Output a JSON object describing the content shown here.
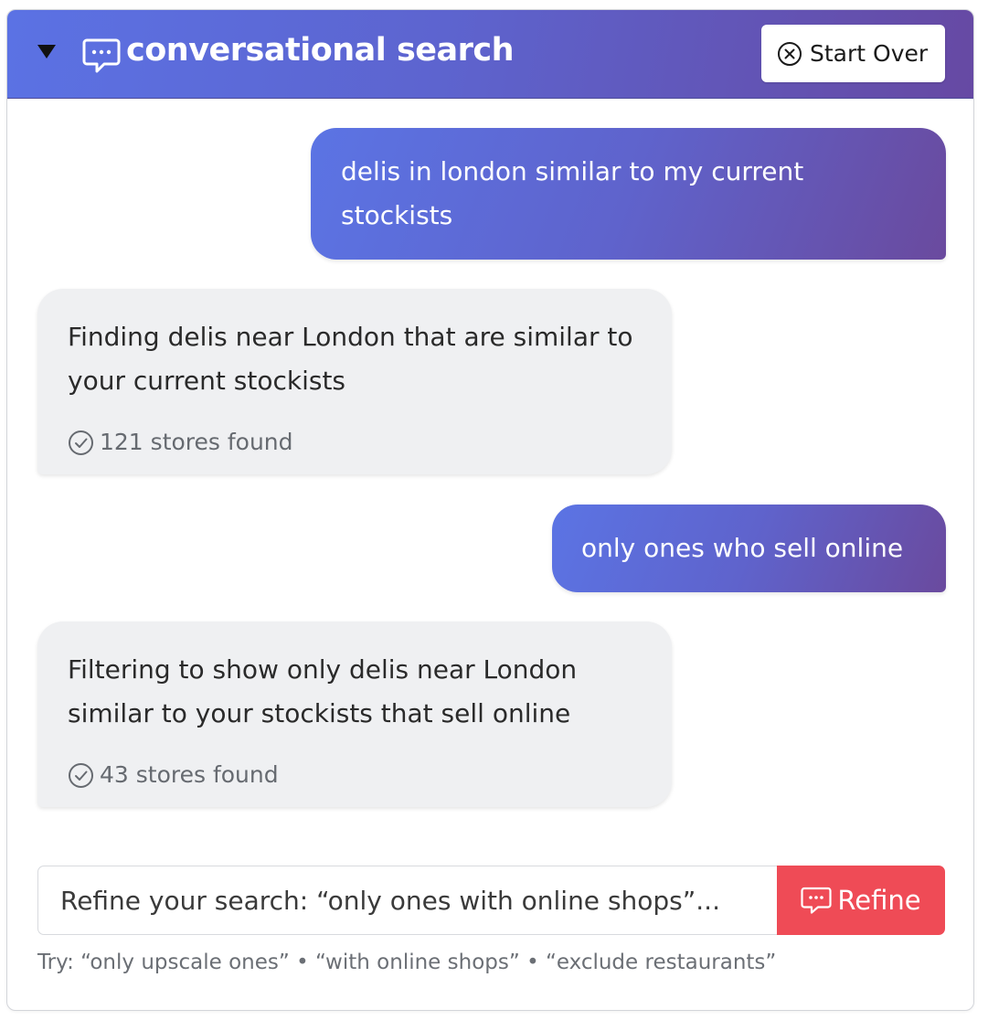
{
  "header": {
    "title": "conversational search",
    "toggle_icon": "triangle-down-icon",
    "title_icon": "chat-bubble-icon",
    "start_over_label": "Start Over",
    "start_over_icon": "circle-x-icon",
    "gradient_start": "#5b72e4",
    "gradient_end": "#6649a3"
  },
  "messages": [
    {
      "role": "user",
      "text": "delis in london similar to my current stockists"
    },
    {
      "role": "assistant",
      "text": "Finding delis near London that are similar to your current stockists",
      "result_count": "121 stores found",
      "result_icon": "check-circle-icon"
    },
    {
      "role": "user",
      "text": "only ones who sell online"
    },
    {
      "role": "assistant",
      "text": "Filtering to show only delis near London similar to your stockists that sell online",
      "result_count": "43 stores found",
      "result_icon": "check-circle-icon"
    }
  ],
  "refine": {
    "placeholder": "Refine your search: “only ones with online shops”...",
    "value": "",
    "button_label": "Refine",
    "button_icon": "chat-bubble-icon",
    "button_color": "#ef4b56"
  },
  "hint": {
    "text": "Try: “only upscale ones” • “with online shops” • “exclude restaurants”"
  },
  "colors": {
    "bot_bubble": "#eff0f2",
    "user_bubble_start": "#5b74e4",
    "user_bubble_end": "#6a4a9e"
  }
}
